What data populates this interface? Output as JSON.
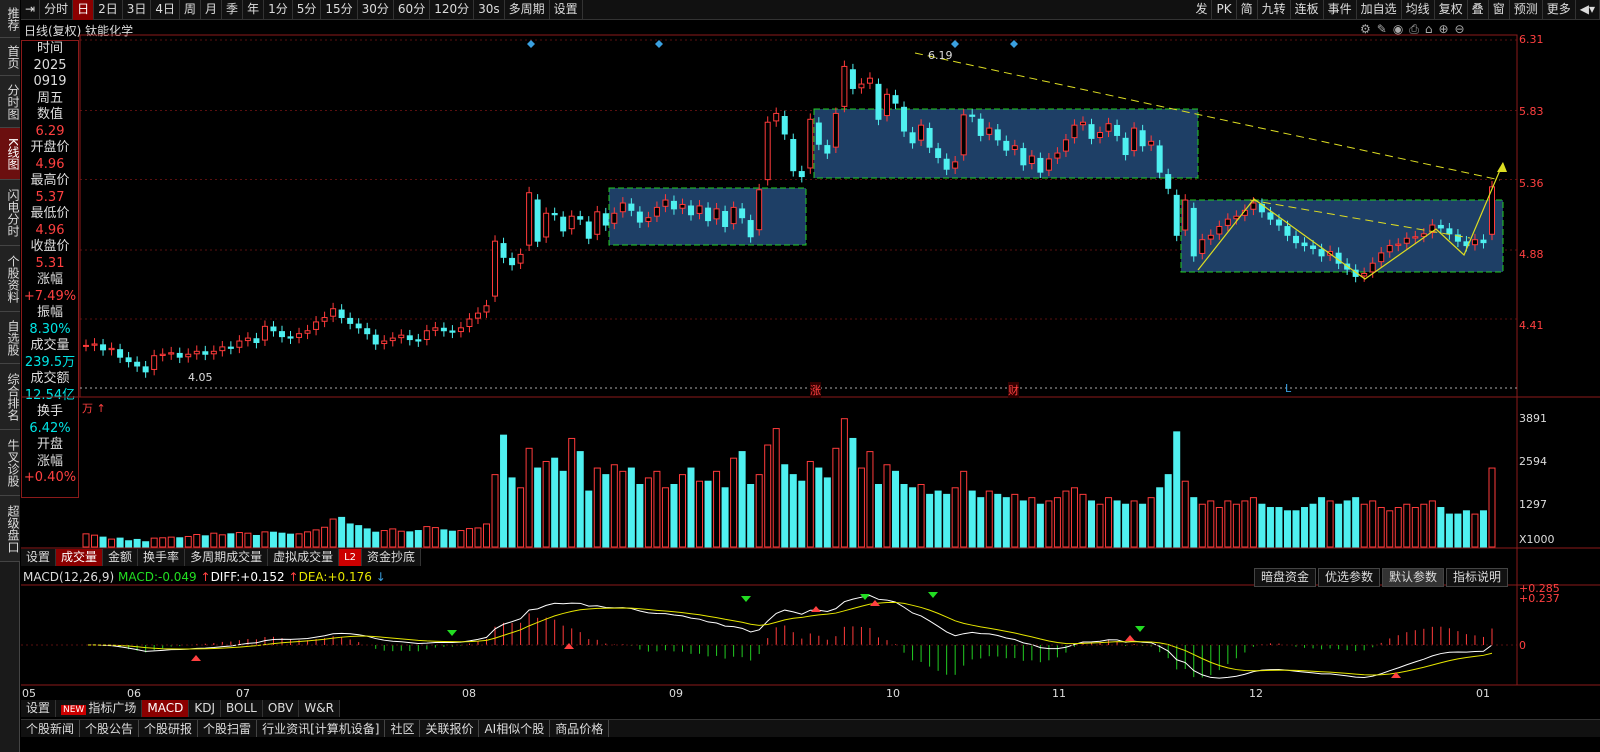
{
  "left_nav": [
    "推荐",
    "首页",
    "分时图",
    "K线图",
    "闪电分时",
    "个股资料",
    "自选股",
    "综合排名",
    "牛叉诊股",
    "超级盘口"
  ],
  "toolbar": {
    "items": [
      "分时",
      "日",
      "2日",
      "3日",
      "4日",
      "周",
      "月",
      "季",
      "年",
      "1分",
      "5分",
      "15分",
      "30分",
      "60分",
      "120分",
      "30s",
      "多周期",
      "设置"
    ],
    "active": "日",
    "right": [
      "发",
      "PK",
      "简",
      "九转",
      "连板",
      "事件",
      "加自选",
      "均线",
      "复权",
      "叠",
      "窗",
      "预测",
      "更多"
    ]
  },
  "chart_title": "日线(复权) 钛能化学",
  "info": {
    "time_label": "时间",
    "year": "2025",
    "date": "0919",
    "weekday": "周五",
    "value_label": "数值",
    "value": "6.29",
    "open_label": "开盘价",
    "open": "4.96",
    "high_label": "最高价",
    "high": "5.37",
    "low_label": "最低价",
    "low": "4.96",
    "close_label": "收盘价",
    "close": "5.31",
    "change_label": "涨幅",
    "change": "+7.49%",
    "amp_label": "振幅",
    "amp": "8.30%",
    "vol_label": "成交量",
    "vol": "239.5万",
    "amt_label": "成交额",
    "amt": "12.54亿",
    "turn_label": "换手",
    "turn": "6.42%",
    "open_chg_label1": "开盘",
    "open_chg_label2": "涨幅",
    "open_chg": "+0.40%"
  },
  "price_axis": [
    "6.31",
    "5.83",
    "5.36",
    "4.88",
    "4.41"
  ],
  "price_annot": {
    "high": "6.19",
    "low": "4.05"
  },
  "markers": {
    "zhang": "涨",
    "cai": "财",
    "l": "L"
  },
  "vol_unit": "万",
  "vol_axis": [
    "3891",
    "2594",
    "1297",
    "X1000"
  ],
  "tabs1": [
    "设置",
    "成交量",
    "金额",
    "换手率",
    "多周期成交量",
    "虚拟成交量",
    "L2",
    "资金抄底"
  ],
  "tabs1_active": "成交量",
  "macd": {
    "name": "MACD(12,26,9)",
    "macd_label": "MACD:",
    "macd": "-0.049",
    "diff_label": "DIFF:",
    "diff": "+0.152",
    "dea_label": "DEA:",
    "dea": "+0.176",
    "axis": [
      "+0.285",
      "+0.237",
      "0"
    ]
  },
  "macd_buttons": [
    "暗盘资金",
    "优选参数",
    "默认参数",
    "指标说明"
  ],
  "macd_active": "默认参数",
  "x_axis": [
    "05",
    "06",
    "07",
    "08",
    "09",
    "10",
    "11",
    "12",
    "01"
  ],
  "tabs2": [
    "设置",
    "指标广场",
    "MACD",
    "KDJ",
    "BOLL",
    "OBV",
    "W&R"
  ],
  "tabs2_new": "NEW",
  "tabs2_active": "MACD",
  "bottom": [
    "个股新闻",
    "个股公告",
    "个股研报",
    "个股扫雷",
    "行业资讯[计算机设备]",
    "社区",
    "关联报价",
    "AI相似个股",
    "商品价格"
  ],
  "colors": {
    "up": "#ff3b3b",
    "down": "#4ff0f0",
    "box": "#1e3f66",
    "box_border": "#22cc22",
    "trend": "#dddd22",
    "diff": "#ffffff",
    "dea": "#e6e600"
  },
  "chart_data": {
    "type": "candlestick",
    "price_range": [
      3.9,
      6.35
    ],
    "close": [
      4.23,
      4.24,
      4.2,
      4.21,
      4.15,
      4.12,
      4.09,
      4.05,
      4.16,
      4.17,
      4.18,
      4.15,
      4.17,
      4.19,
      4.17,
      4.19,
      4.22,
      4.21,
      4.26,
      4.28,
      4.25,
      4.36,
      4.33,
      4.29,
      4.28,
      4.31,
      4.33,
      4.39,
      4.42,
      4.48,
      4.42,
      4.38,
      4.35,
      4.31,
      4.24,
      4.26,
      4.28,
      4.3,
      4.27,
      4.26,
      4.33,
      4.35,
      4.33,
      4.32,
      4.35,
      4.41,
      4.45,
      4.5,
      4.94,
      4.83,
      4.78,
      4.85,
      5.27,
      4.94,
      5.13,
      5.12,
      5.01,
      5.11,
      5.09,
      4.96,
      5.14,
      5.05,
      5.13,
      5.2,
      5.15,
      5.07,
      5.1,
      5.17,
      5.22,
      5.16,
      5.19,
      5.12,
      5.18,
      5.08,
      5.16,
      5.04,
      5.17,
      5.1,
      4.97,
      5.29,
      5.75,
      5.81,
      5.67,
      5.42,
      5.38,
      5.77,
      5.6,
      5.54,
      5.81,
      6.13,
      5.98,
      6.01,
      6.05,
      5.77,
      5.94,
      5.88,
      5.69,
      5.61,
      5.73,
      5.58,
      5.51,
      5.43,
      5.48,
      5.8,
      5.79,
      5.66,
      5.71,
      5.63,
      5.56,
      5.59,
      5.46,
      5.52,
      5.41,
      5.5,
      5.54,
      5.63,
      5.73,
      5.75,
      5.64,
      5.68,
      5.74,
      5.66,
      5.53,
      5.71,
      5.59,
      5.62,
      5.41,
      5.3,
      4.98,
      5.22,
      4.84,
      4.95,
      4.98,
      5.04,
      5.09,
      5.11,
      5.15,
      5.2,
      5.14,
      5.09,
      5.05,
      4.98,
      4.93,
      4.91,
      4.89,
      4.84,
      4.87,
      4.79,
      4.75,
      4.7,
      4.72,
      4.79,
      4.86,
      4.91,
      4.92,
      4.96,
      4.97,
      4.99,
      5.05,
      5.03,
      4.99,
      4.94,
      4.91,
      4.95,
      4.93,
      5.31
    ],
    "volume_x1000": [
      400,
      360,
      300,
      240,
      270,
      190,
      230,
      160,
      270,
      280,
      300,
      280,
      320,
      380,
      340,
      420,
      370,
      400,
      440,
      420,
      350,
      460,
      450,
      420,
      390,
      400,
      460,
      520,
      600,
      850,
      900,
      700,
      650,
      550,
      450,
      500,
      550,
      480,
      460,
      500,
      620,
      590,
      520,
      480,
      500,
      560,
      580,
      700,
      2200,
      3400,
      2100,
      1800,
      3000,
      2400,
      2600,
      2700,
      2300,
      3300,
      2900,
      1700,
      2400,
      2200,
      2500,
      2300,
      2400,
      1900,
      2100,
      2300,
      1800,
      1900,
      2200,
      2400,
      2000,
      2000,
      2300,
      1800,
      2700,
      2900,
      1900,
      2200,
      3100,
      3600,
      2500,
      2200,
      2000,
      2600,
      2400,
      2100,
      3000,
      3900,
      3300,
      2400,
      2900,
      1900,
      2500,
      2300,
      1900,
      1800,
      1900,
      1600,
      1700,
      1600,
      1800,
      2300,
      1700,
      1500,
      1700,
      1600,
      1500,
      1600,
      1400,
      1500,
      1300,
      1400,
      1500,
      1700,
      1800,
      1600,
      1400,
      1300,
      1500,
      1400,
      1300,
      1400,
      1300,
      1500,
      1800,
      2200,
      3500,
      2000,
      1500,
      1300,
      1400,
      1200,
      1400,
      1300,
      1400,
      1500,
      1300,
      1200,
      1200,
      1100,
      1100,
      1200,
      1300,
      1500,
      1400,
      1300,
      1400,
      1500,
      1300,
      1400,
      1200,
      1100,
      1200,
      1300,
      1200,
      1300,
      1400,
      1200,
      1000,
      1000,
      1100,
      1000,
      1100,
      2400
    ]
  }
}
